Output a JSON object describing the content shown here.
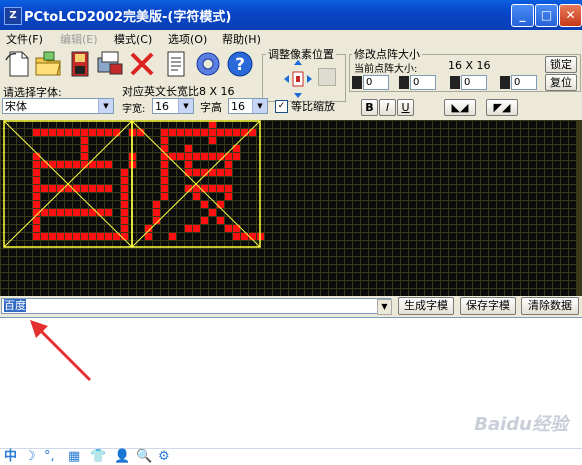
{
  "window": {
    "title": "PCtoLCD2002完美版-(字符模式)",
    "app_icon_text": "Z"
  },
  "menu": [
    {
      "label": "文件(F)",
      "enabled": true
    },
    {
      "label": "编辑(E)",
      "enabled": false
    },
    {
      "label": "模式(C)",
      "enabled": true
    },
    {
      "label": "选项(O)",
      "enabled": true
    },
    {
      "label": "帮助(H)",
      "enabled": true
    }
  ],
  "toolbar": {
    "font_label": "请选择字体:",
    "font_value": "宋体",
    "english_ratio_label": "对应英文长宽比8 X 16",
    "width_label": "字宽:",
    "width_value": "16",
    "height_label": "字高",
    "height_value": "16",
    "proportional_label": "等比缩放",
    "proportional_checked": true,
    "style_buttons": [
      "B",
      "I",
      "U"
    ],
    "pixel_group_title": "调整像素位置",
    "resize_group_title": "修改点阵大小",
    "current_size_label": "当前点阵大小:",
    "current_size_value": "16 X 16",
    "lock_button": "锁定",
    "reset_button": "复位",
    "spin_values": [
      "0",
      "0",
      "0",
      "0"
    ]
  },
  "canvas": {
    "background_color": "#3a3a18",
    "dot_on_color": "#ff1010",
    "dot_off_color": "#0c0c0c",
    "guide_color": "#ffff40",
    "characters": [
      "百",
      "度"
    ]
  },
  "input": {
    "text": "百度",
    "generate_button": "生成字模",
    "save_button": "保存字模",
    "clear_button": "清除数据"
  },
  "taskbar": {
    "ime_items": [
      "中",
      "☽",
      "°,",
      "▦",
      "👕",
      "👤",
      "🔍",
      "⚙"
    ]
  },
  "watermark": "Baidu经验"
}
